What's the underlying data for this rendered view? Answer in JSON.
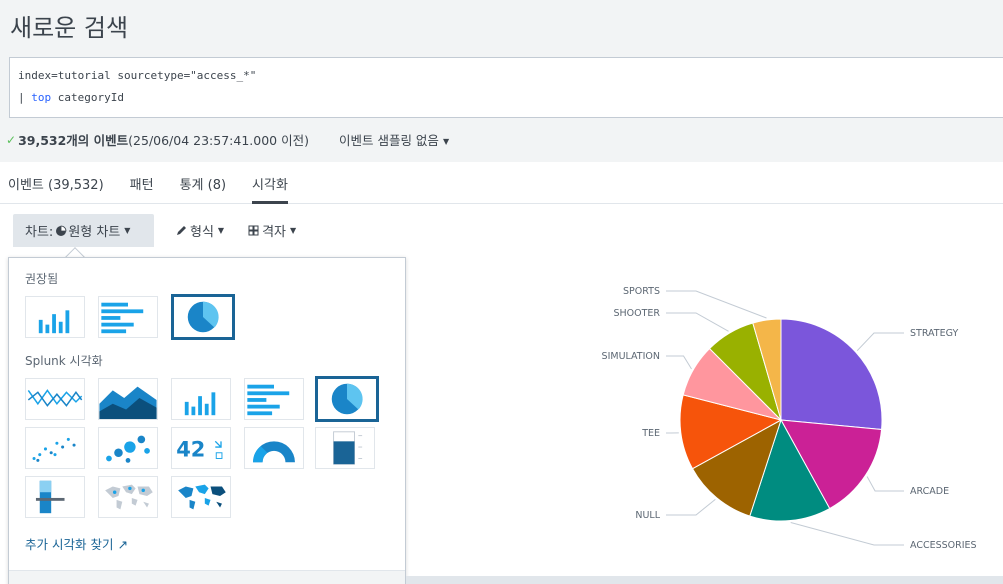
{
  "page": {
    "title": "새로운 검색"
  },
  "search": {
    "line1": "index=tutorial sourcetype=\"access_*\"",
    "line2_prefix": "| ",
    "line2_keyword": "top",
    "line2_rest": " categoryId"
  },
  "status": {
    "check": "✓",
    "count": "39,532개의 이벤트",
    "time": " (25/06/04 23:57:41.000 이전)",
    "sampling": "이벤트 샘플링 없음"
  },
  "tabs": [
    {
      "label": "이벤트 (39,532)"
    },
    {
      "label": "패턴"
    },
    {
      "label": "통계 (8)"
    },
    {
      "label": "시각화"
    }
  ],
  "toolbar": {
    "chart_button": "차트:",
    "chart_type": " 원형 차트",
    "format_button": "형식",
    "grid_button": "격자"
  },
  "viz_panel": {
    "recommended_label": "권장됨",
    "splunk_label": "Splunk 시각화",
    "single_value": "42",
    "find_more": "추가 시각화 찾기"
  },
  "colors": {
    "accent": "#1a6496",
    "icon_blue": "#1aa3e8",
    "selected_border": "#1a6496"
  },
  "chart_data": {
    "type": "pie",
    "slices": [
      {
        "label": "STRATEGY",
        "value": 26.5,
        "color": "#7b56db"
      },
      {
        "label": "ARCADE",
        "value": 15.5,
        "color": "#cb2196"
      },
      {
        "label": "ACCESSORIES",
        "value": 13.0,
        "color": "#008c80"
      },
      {
        "label": "NULL",
        "value": 12.0,
        "color": "#9d6300"
      },
      {
        "label": "TEE",
        "value": 12.0,
        "color": "#f6540b"
      },
      {
        "label": "SIMULATION",
        "value": 8.5,
        "color": "#ff969e"
      },
      {
        "label": "SHOOTER",
        "value": 8.0,
        "color": "#99b100"
      },
      {
        "label": "SPORTS",
        "value": 4.5,
        "color": "#f4b649"
      }
    ]
  }
}
